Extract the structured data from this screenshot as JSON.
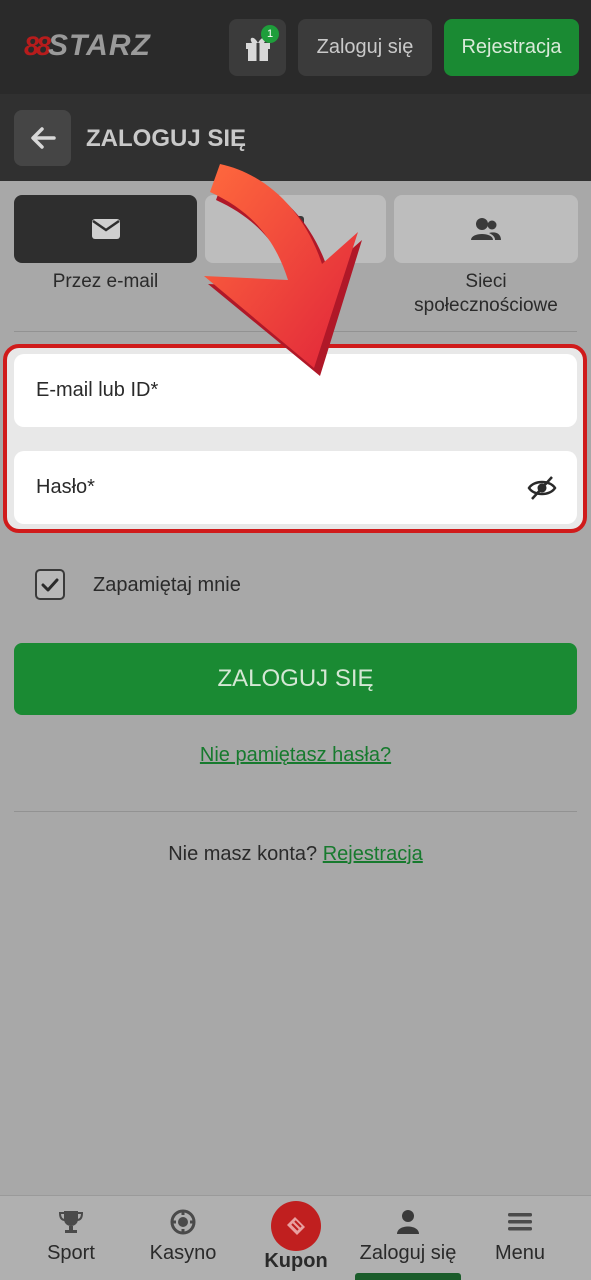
{
  "header": {
    "logo_prefix": "88",
    "logo_text": "STARZ",
    "gift_badge": "1",
    "login_label": "Zaloguj się",
    "register_label": "Rejestracja"
  },
  "subheader": {
    "title": "ZALOGUJ SIĘ"
  },
  "login_methods": [
    {
      "label": "Przez e-mail",
      "icon": "envelope-icon",
      "active": true
    },
    {
      "label": "",
      "icon": "phone-icon",
      "active": false
    },
    {
      "label": "Sieci\nspołecznościowe",
      "icon": "users-icon",
      "active": false
    }
  ],
  "form": {
    "email_placeholder": "E-mail lub ID*",
    "password_placeholder": "Hasło*",
    "remember_label": "Zapamiętaj mnie",
    "remember_checked": true,
    "submit_label": "ZALOGUJ SIĘ",
    "forgot_label": "Nie pamiętasz hasła?",
    "no_account_text": "Nie masz konta?",
    "register_link": "Rejestracja"
  },
  "bottom_nav": [
    {
      "label": "Sport",
      "icon": "trophy-icon"
    },
    {
      "label": "Kasyno",
      "icon": "casino-chip-icon"
    },
    {
      "label": "Kupon",
      "icon": "ticket-icon"
    },
    {
      "label": "Zaloguj się",
      "icon": "user-icon",
      "active": true
    },
    {
      "label": "Menu",
      "icon": "hamburger-icon"
    }
  ],
  "colors": {
    "accent_green": "#1a8a33",
    "highlight_red": "#d01b1b",
    "arrow_red": "#f2453a"
  }
}
